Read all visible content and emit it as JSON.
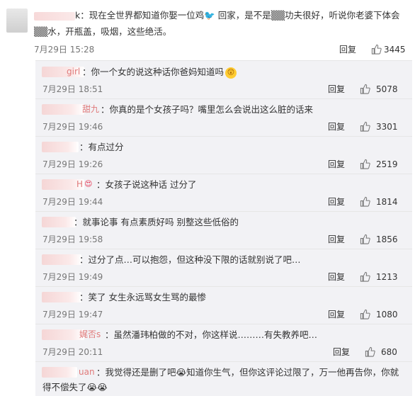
{
  "main_comment": {
    "text": "k：现在全世界都知道你娶一位鸡🐦 回家，是不是▒▒功夫很好，听说你老婆下体会▒▒水，开瓶盖，吸烟，这些绝活。",
    "name_suffix": "k",
    "time": "7月29日 15:28",
    "reply_label": "回复",
    "likes": "3445"
  },
  "replies": [
    {
      "name_suffix": "girl",
      "text": "：你一个女的说这种话你爸妈知道吗",
      "emoji": "😲",
      "time": "7月29日 18:51",
      "reply_label": "回复",
      "likes": "5078"
    },
    {
      "name_suffix": "甜九",
      "text": "：你真的是个女孩子吗？嘴里怎么会说出这么脏的话来",
      "emoji": "",
      "time": "7月29日 19:46",
      "reply_label": "回复",
      "likes": "3301"
    },
    {
      "name_suffix": "",
      "text": "：有点过分",
      "emoji": "",
      "time": "7月29日 19:26",
      "reply_label": "回复",
      "likes": "2519"
    },
    {
      "name_suffix": "H",
      "text": "：女孩子说这种话 过分了",
      "emoji": "",
      "time": "7月29日 19:44",
      "reply_label": "回复",
      "likes": "1814"
    },
    {
      "name_suffix": "",
      "text": "：就事论事 有点素质好吗 别整这些低俗的",
      "emoji": "",
      "time": "7月29日 19:58",
      "reply_label": "回复",
      "likes": "1856"
    },
    {
      "name_suffix": "",
      "text": "：过分了点…可以抱怨，但这种没下限的话就别说了吧…",
      "emoji": "",
      "time": "7月29日 19:49",
      "reply_label": "回复",
      "likes": "1213"
    },
    {
      "name_suffix": "",
      "text": "：笑了 女生永远骂女生骂的最惨",
      "emoji": "",
      "time": "7月29日 19:47",
      "reply_label": "回复",
      "likes": "1080"
    },
    {
      "name_suffix": "娓否s",
      "text": "：虽然潘玮柏做的不对，你这样说………有失教养吧…",
      "emoji": "",
      "time": "7月29日 20:11",
      "reply_label": "回复",
      "likes": "680"
    },
    {
      "name_suffix": "uan",
      "text": "：我觉得还是删了吧😭知道你生气，但你这评论过限了，万一他再告你，你就",
      "text2": "得不偿失了😭😭",
      "emoji": "",
      "time": "",
      "reply_label": "",
      "likes": ""
    }
  ]
}
